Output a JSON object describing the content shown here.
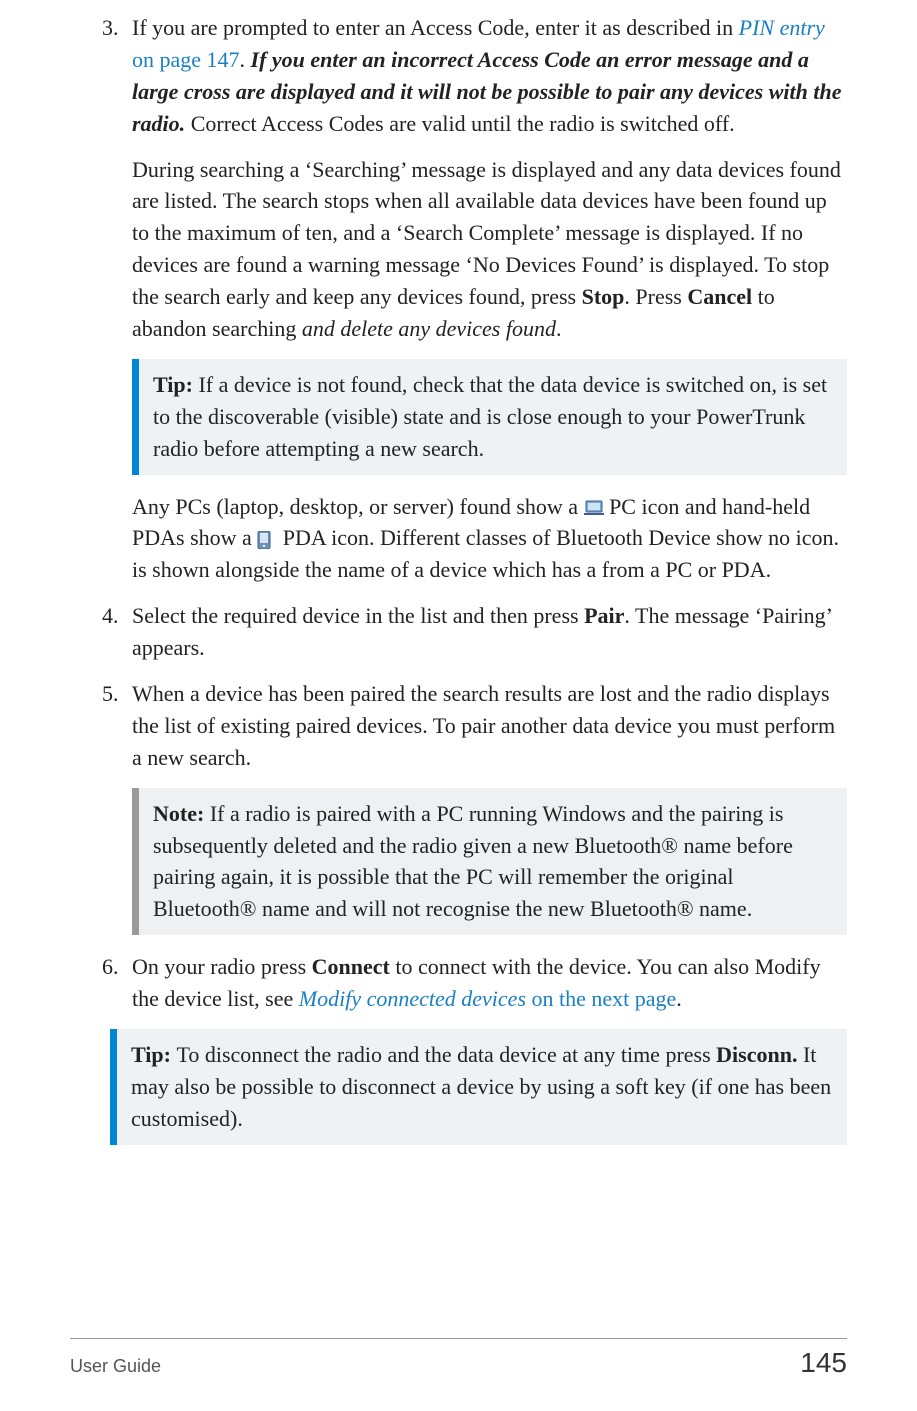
{
  "steps": {
    "s3": {
      "num": "3.",
      "p1_a": "If you are prompted to enter an Access Code, enter it as described in ",
      "p1_link": "PIN entry",
      "p1_linkpage": " on page 147",
      "p1_b": ". ",
      "p1_bi": "If you enter an incorrect Access Code an error message and a large cross are displayed and it will not be possible to pair any devices with the radio.",
      "p1_c": " Correct Access Codes are valid until the radio is switched off.",
      "p2_a": "During searching a ‘Searching’ message is displayed and any data devices found are listed. The search stops when all available data devices have been found up to the maximum of ten, and a ‘Search Complete’ message is displayed. If no devices are found a warning message ‘No Devices Found’ is displayed. To stop the search early and keep any devices found, press ",
      "p2_stop": "Stop",
      "p2_b": ". Press ",
      "p2_cancel": "Cancel",
      "p2_c": " to abandon searching ",
      "p2_i": "and delete any devices found",
      "p2_d": ".",
      "tip_lbl": "Tip:  ",
      "tip_txt": "If a device is not found, check that the data device is switched on, is set to the discoverable (visible) state and is close enough to your PowerTrunk radio before attempting a new search.",
      "p3_a": "Any PCs (laptop, desktop, or server) found show a ",
      "p3_b": " PC icon and hand-held PDAs show a ",
      "p3_c": " PDA icon. Different classes of Bluetooth Device show no icon. is shown alongside the name of a device which has a from a PC or PDA."
    },
    "s4": {
      "num": "4.",
      "a": "Select the required device in the list and then press ",
      "pair": "Pair",
      "b": ". The message ‘Pairing’ appears."
    },
    "s5": {
      "num": "5.",
      "p1": "When a device has been paired the search results are lost and the radio displays the list of existing paired devices. To pair another data device you must perform a new search.",
      "note_lbl": "Note:  ",
      "note_txt": "If a radio is paired with a PC running Windows and the pairing is subsequently deleted and the radio given a new Bluetooth® name before pairing again, it is possible that the PC will remember the original Bluetooth® name and will not recognise the new Bluetooth® name."
    },
    "s6": {
      "num": "6.",
      "a": "On your radio press ",
      "connect": "Connect",
      "b": " to connect with the device. You can also Modify the device list, see ",
      "link": "Modify connected devices",
      "linkpage": " on the next page",
      "c": "."
    }
  },
  "tip2": {
    "lbl": "Tip:  ",
    "a": "To disconnect the radio and the data device at any time press ",
    "disconn": "Disconn.",
    "b": " It may also be possible to disconnect a device by using a soft key (if one has been customised)."
  },
  "footer": {
    "guide": "User Guide",
    "page": "145"
  }
}
